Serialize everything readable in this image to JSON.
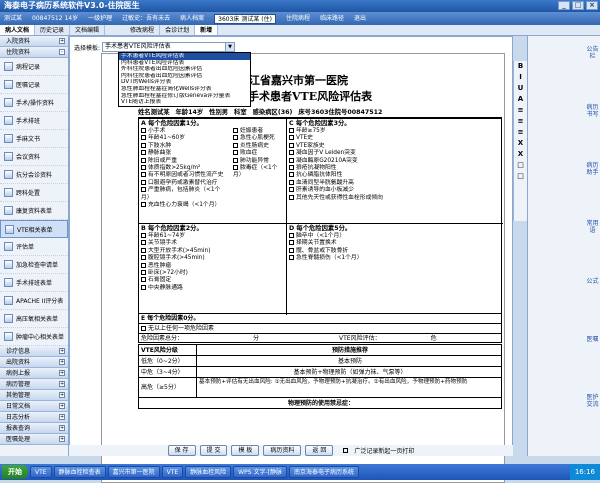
{
  "app": {
    "title": "海泰电子病历系统软件V3.0-住院医生",
    "win_min": "_",
    "win_max": "□",
    "win_close": "×"
  },
  "infobar": {
    "items": [
      "测试某",
      "00847512 14岁",
      "一级护理",
      "过敏史：吾有未去"
    ],
    "patient_btn": "病人档案",
    "bed_select": "3603床  测试某 (住)",
    "history": "住院病程",
    "menu2": "临床路径",
    "menu3": "退出"
  },
  "tabs": [
    "病人文档",
    "历史记录",
    "文档编辑"
  ],
  "subtabs": [
    "修改病程",
    "会诊计划",
    "新增"
  ],
  "sidebar": {
    "sections_top": [
      "入院资料",
      "住院资料"
    ],
    "items": [
      "病程记录",
      "医嘱记录",
      "手术/操作资料",
      "手术排班",
      "手麻文书",
      "会议资料",
      "抗分会诊资料",
      "跨科处置",
      "康复资料表单",
      "VTE相关表单",
      "评估单",
      "加急检查申请单",
      "手术排班表单",
      "APACHE II评分表",
      "高压氧相关表单",
      "肿瘤中心相关表单"
    ],
    "selected_index": 9,
    "sections_bottom": [
      "诊疗信息",
      "出院资料",
      "病例上报",
      "病历管理",
      "其他管理",
      "日常文档",
      "日志分析",
      "报表查询",
      "医嘱处理"
    ]
  },
  "template": {
    "label": "选择模板:",
    "value": "手术患者VTE风险评估表",
    "options": [
      "手术患者VTE风险评估表",
      "内科患者VTE风险评估表",
      "外科住院患者出血危险因素评估",
      "内科住院患者出血危险因素评估",
      "DVT的Wells评分表",
      "急性肺血栓栓塞症简化Wells评分表",
      "急性肺血栓栓塞症修订版Geneva评分量表",
      "VTE随访上报表"
    ],
    "highlight_index": 0
  },
  "form": {
    "hospital": "浙江省嘉兴市第一医院",
    "title": "手术患者VTE风险评估表",
    "patient": [
      "姓名测试某",
      "年龄14岁",
      "性别男",
      "科室",
      "感染病区(36)",
      "床号3603住院号00847512"
    ],
    "A": {
      "header": "A  每个危险因素1分。",
      "items": [
        "小手术",
        "年龄41~60岁",
        "下肢水肿",
        "静脉曲张",
        "陈旧或严重",
        "体质指数>25kg/m²",
        "有不明原因或者习惯性流产史",
        "口服避孕药或激素替代治疗",
        "严重肺病，包括肺炎（<1个月）",
        "充血性心力衰竭（<1个月）"
      ],
      "items_right": [
        "妊娠患者",
        "急性心肌梗死",
        "炎性肠病史",
        "败血症",
        "肺功能异常",
        "脓毒症（<1个月）"
      ]
    },
    "C": {
      "header": "C  每个危险因素3分。",
      "items": [
        "年龄≥75岁",
        "VTE史",
        "VTE家族史",
        "凝血因子V Leiden突变",
        "凝血酶原G20210A突变",
        "狼疮抗凝物阳性",
        "抗心磷脂抗体阳性",
        "血清同型半胱氨酸升高",
        "肝素诱导的血小板减少",
        "其他先天性或获得性血栓形成倾向"
      ]
    },
    "B": {
      "header": "B  每个危险因素2分。",
      "items": [
        "年龄61~74岁",
        "关节镜手术",
        "大型开放手术(>45min)",
        "腹腔镜手术(>45min)",
        "恶性肿瘤",
        "卧床(>72小时)",
        "石膏固定",
        "中央静脉通路"
      ]
    },
    "D": {
      "header": "D  每个危险因素5分。",
      "items": [
        "脑卒中（<1个月）",
        "择期关节置换术",
        "髋、骨盆或下肢骨折",
        "急性脊髓损伤（<1个月）"
      ]
    },
    "E": {
      "header": "E  每个危险因素0分。",
      "item": "无以上任何一项危险因素"
    },
    "score": {
      "label": "危险因素总分：",
      "unit": "分",
      "vte_label": "VTE风险评估：",
      "unit2": "危"
    },
    "table": {
      "h1": "VTE风险分级",
      "h2": "预防措施推荐",
      "rows": [
        [
          "低危（0~2分）",
          "基本预防"
        ],
        [
          "中危（3~4分）",
          "基本预防+物理预防（如弹力袜、气泵等）"
        ],
        [
          "高危（≥5分）",
          "基本预防+评估有无出血风险:  ①无出血风险，予物理预防+抗凝治疗。②有出血风险，予物理预防+药物预防"
        ]
      ],
      "foot": "物理预防的使用禁忌症："
    }
  },
  "buttons": [
    "保 存",
    "提 交",
    "模 板",
    "病历资料",
    "返 回"
  ],
  "checkbox_label": "广泛记录新起一页打印",
  "vtools": [
    "B",
    "I",
    "U",
    "A",
    "≡",
    "≡",
    "≡",
    "X",
    "X",
    "□",
    "□"
  ],
  "rightpanel": [
    "公告栏",
    "病历书写",
    "病历助手",
    "常用语",
    "公式",
    "医嘱",
    "医护交流"
  ],
  "status": "",
  "taskbar": {
    "start": "开始",
    "tasks": [
      "VTE",
      "静脉血栓检查表",
      "嘉兴市第一医院",
      "VTE",
      "静脉血栓风险",
      "WPS 文字-[静脉",
      "南京海泰电子病历系统"
    ],
    "clock": "16:16"
  }
}
